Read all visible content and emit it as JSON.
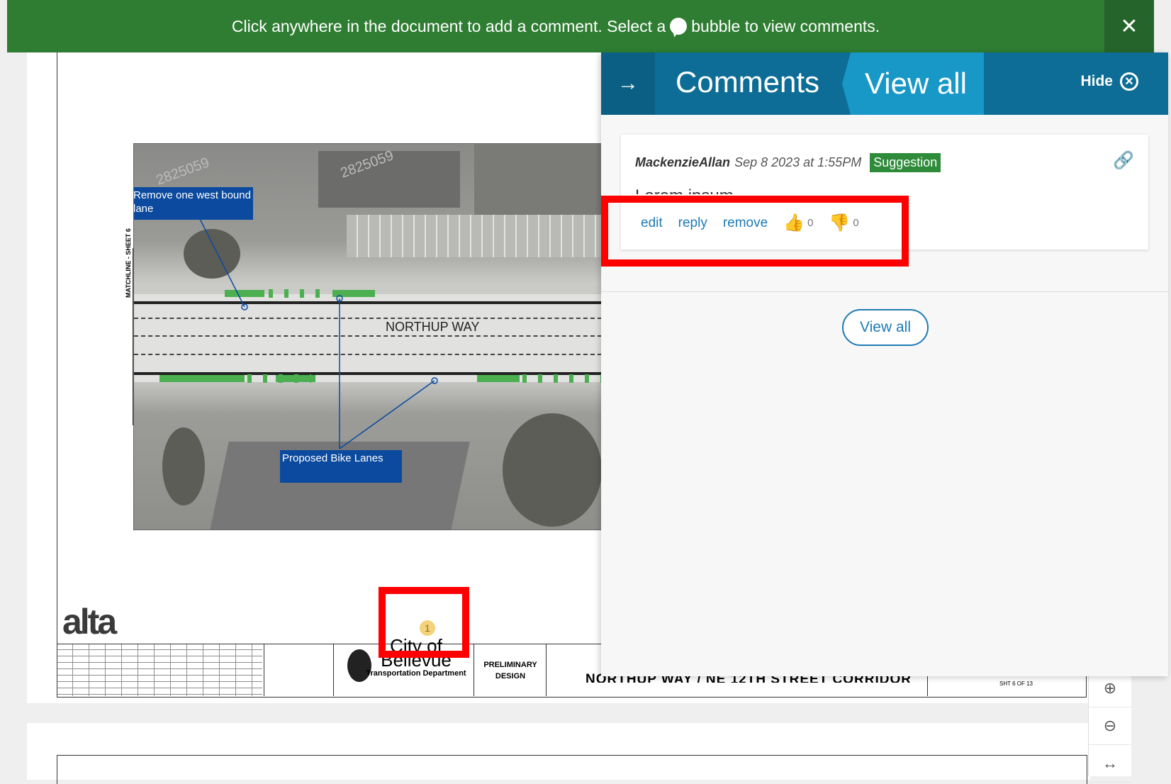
{
  "banner": {
    "message_before": "Click anywhere in the document to add a comment. Select a",
    "message_after": "bubble to view comments.",
    "close_label": "✕"
  },
  "map": {
    "road_label": "NORTHUP WAY",
    "callout_1": "Remove one west bound lane",
    "callout_2": "Proposed Bike Lanes",
    "matchline": "MATCHLINE - SHEET 6",
    "parcel_1": "2825059",
    "parcel_2": "2825059"
  },
  "titleblock": {
    "firm_logo": "alta",
    "city_line1": "City of",
    "city_line2": "Bellevue",
    "department": "Transportation Department",
    "status": "PRELIMINARY DESIGN",
    "project": "NORTHUP WAY / NE 12TH STREET CORRIDOR",
    "sheet": "SHT 6 OF 13"
  },
  "marker": {
    "number": "1"
  },
  "panel": {
    "header_arrow": "→",
    "title": "Comments",
    "view_all_tab": "View all",
    "hide_label": "Hide",
    "comment": {
      "author": "MackenzieAllan",
      "date": "Sep 8 2023 at 1:55PM",
      "tag": "Suggestion",
      "body": "Lorem ipsum",
      "actions": {
        "edit": "edit",
        "reply": "reply",
        "remove": "remove"
      },
      "upvotes": "0",
      "downvotes": "0"
    },
    "view_all_button": "View all"
  },
  "zoom": {
    "zoom_in": "⊕",
    "zoom_out": "⊖",
    "fit_width": "↔"
  },
  "colors": {
    "banner": "#2e7d32",
    "panel_header": "#0d6d96",
    "accent": "#1e7bb5",
    "suggestion_tag": "#2e8b3a",
    "highlight": "#ff0000"
  }
}
